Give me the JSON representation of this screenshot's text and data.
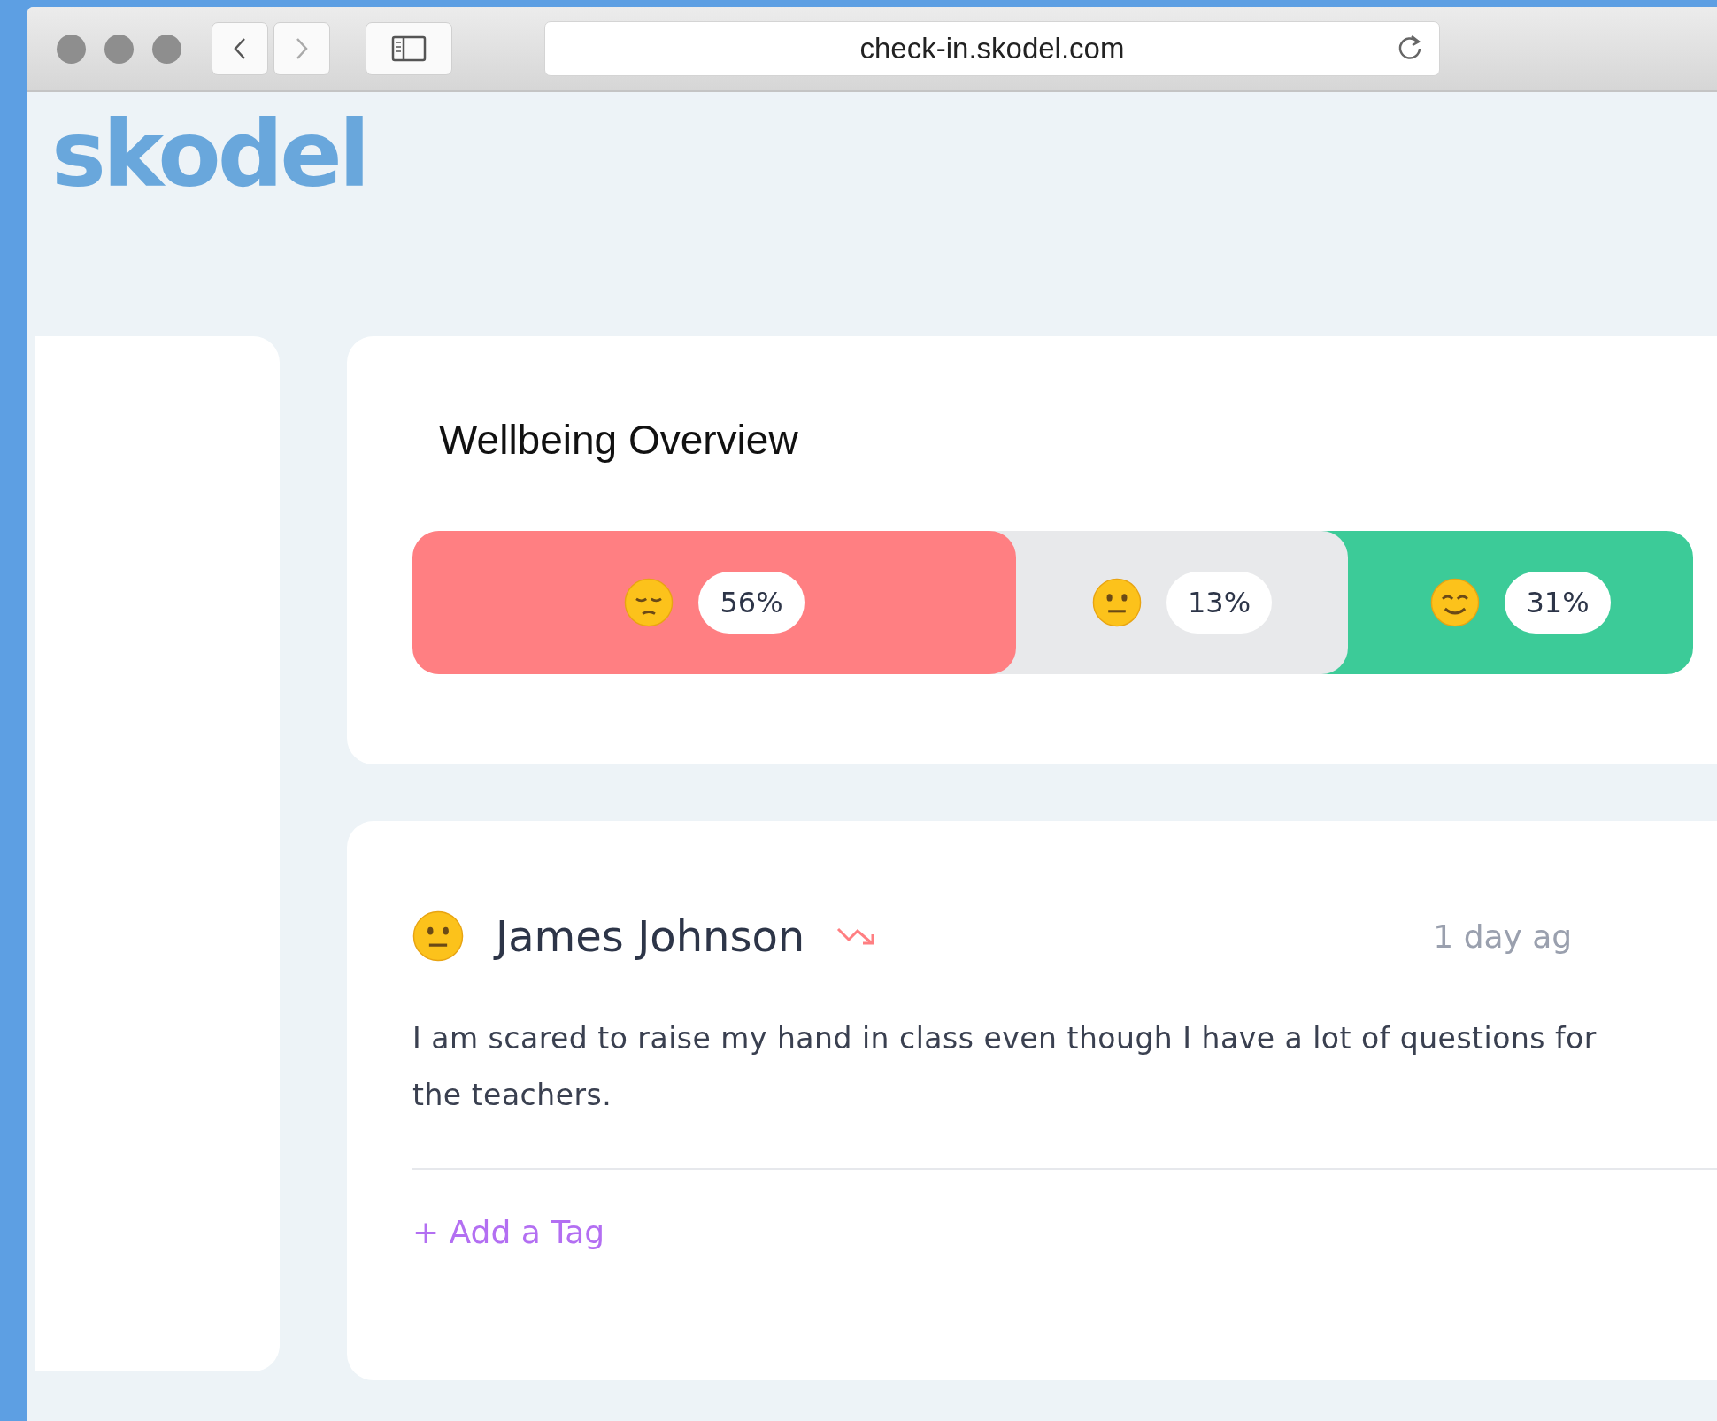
{
  "browser": {
    "url": "check-in.skodel.com"
  },
  "logo": "skodel",
  "overview": {
    "title": "Wellbeing Overview",
    "segments": [
      {
        "kind": "sad",
        "percent": "56%",
        "color": "#ff7f82"
      },
      {
        "kind": "neutral",
        "percent": "13%",
        "color": "#e8e9eb"
      },
      {
        "kind": "happy",
        "percent": "31%",
        "color": "#3ccb98"
      }
    ]
  },
  "checkin": {
    "emoji": {
      "kind": "neutral"
    },
    "name": "James Johnson",
    "trend": {
      "kind": "down"
    },
    "time": "1 day ag",
    "message": "I am scared to raise my hand in class even though I have a lot of questions for the teachers.",
    "add_tag": "+ Add a Tag"
  }
}
